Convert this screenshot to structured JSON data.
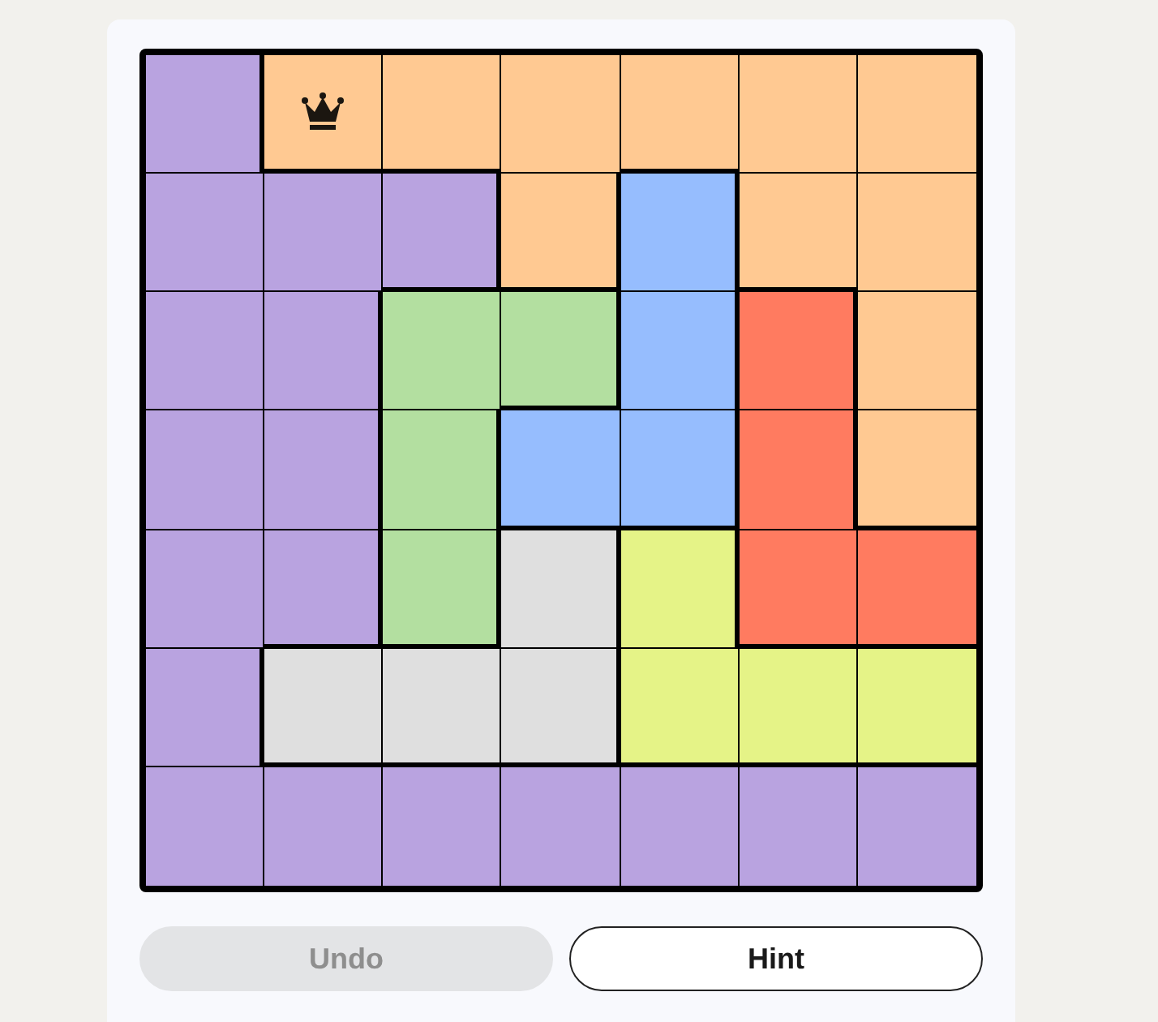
{
  "board": {
    "rows": [
      [
        {
          "color": "#b9a3e0",
          "queen": false
        },
        {
          "color": "#ffc992",
          "queen": true
        },
        {
          "color": "#ffc992",
          "queen": false
        },
        {
          "color": "#ffc992",
          "queen": false
        },
        {
          "color": "#ffc992",
          "queen": false
        },
        {
          "color": "#ffc992",
          "queen": false
        },
        {
          "color": "#ffc992",
          "queen": false
        }
      ],
      [
        {
          "color": "#b9a3e0",
          "queen": false
        },
        {
          "color": "#b9a3e0",
          "queen": false
        },
        {
          "color": "#b9a3e0",
          "queen": false
        },
        {
          "color": "#ffc992",
          "queen": false
        },
        {
          "color": "#96bdfe",
          "queen": false
        },
        {
          "color": "#ffc992",
          "queen": false
        },
        {
          "color": "#ffc992",
          "queen": false
        }
      ],
      [
        {
          "color": "#b9a3e0",
          "queen": false
        },
        {
          "color": "#b9a3e0",
          "queen": false
        },
        {
          "color": "#b3dfa0",
          "queen": false
        },
        {
          "color": "#b3dfa0",
          "queen": false
        },
        {
          "color": "#96bdfe",
          "queen": false
        },
        {
          "color": "#ff7b60",
          "queen": false
        },
        {
          "color": "#ffc992",
          "queen": false
        }
      ],
      [
        {
          "color": "#b9a3e0",
          "queen": false
        },
        {
          "color": "#b9a3e0",
          "queen": false
        },
        {
          "color": "#b3dfa0",
          "queen": false
        },
        {
          "color": "#96bdfe",
          "queen": false
        },
        {
          "color": "#96bdfe",
          "queen": false
        },
        {
          "color": "#ff7b60",
          "queen": false
        },
        {
          "color": "#ffc992",
          "queen": false
        }
      ],
      [
        {
          "color": "#b9a3e0",
          "queen": false
        },
        {
          "color": "#b9a3e0",
          "queen": false
        },
        {
          "color": "#b3dfa0",
          "queen": false
        },
        {
          "color": "#dfdfdf",
          "queen": false
        },
        {
          "color": "#e5f387",
          "queen": false
        },
        {
          "color": "#ff7b60",
          "queen": false
        },
        {
          "color": "#ff7b60",
          "queen": false
        }
      ],
      [
        {
          "color": "#b9a3e0",
          "queen": false
        },
        {
          "color": "#dfdfdf",
          "queen": false
        },
        {
          "color": "#dfdfdf",
          "queen": false
        },
        {
          "color": "#dfdfdf",
          "queen": false
        },
        {
          "color": "#e5f387",
          "queen": false
        },
        {
          "color": "#e5f387",
          "queen": false
        },
        {
          "color": "#e5f387",
          "queen": false
        }
      ],
      [
        {
          "color": "#b9a3e0",
          "queen": false
        },
        {
          "color": "#b9a3e0",
          "queen": false
        },
        {
          "color": "#b9a3e0",
          "queen": false
        },
        {
          "color": "#b9a3e0",
          "queen": false
        },
        {
          "color": "#b9a3e0",
          "queen": false
        },
        {
          "color": "#b9a3e0",
          "queen": false
        },
        {
          "color": "#b9a3e0",
          "queen": false
        }
      ]
    ]
  },
  "buttons": [
    {
      "label": "Undo",
      "disabled": true
    },
    {
      "label": "Hint",
      "disabled": false
    }
  ]
}
